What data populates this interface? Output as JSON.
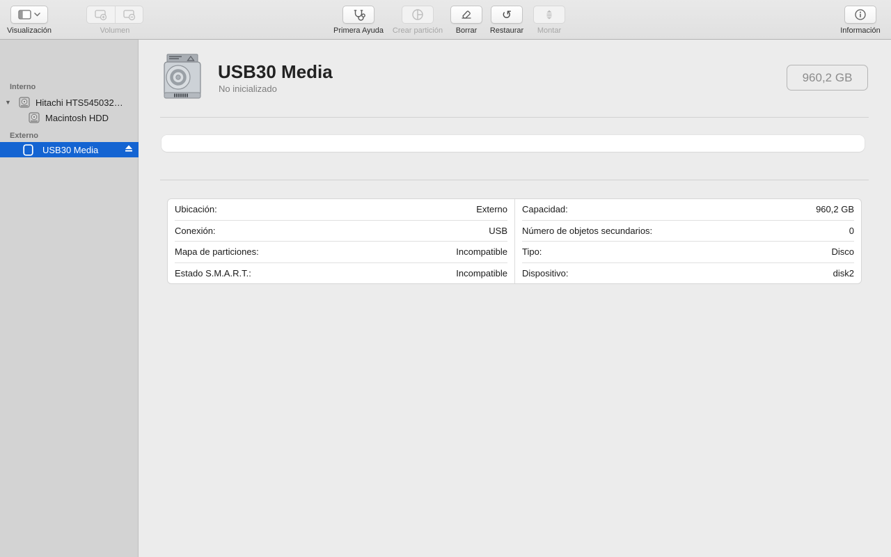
{
  "colors": {
    "selection_blue": "#1464d2"
  },
  "toolbar": {
    "visualizacion": {
      "label": "Visualización"
    },
    "volumen": {
      "label": "Volumen"
    },
    "primera_ayuda": {
      "label": "Primera Ayuda"
    },
    "crear_particion": {
      "label": "Crear partición"
    },
    "borrar": {
      "label": "Borrar"
    },
    "restaurar": {
      "label": "Restaurar",
      "glyph": "↺"
    },
    "montar": {
      "label": "Montar"
    },
    "informacion": {
      "label": "Información"
    }
  },
  "sidebar": {
    "sections": [
      {
        "title": "Interno",
        "items": [
          {
            "label": "Hitachi HTS545032…"
          },
          {
            "label": "Macintosh HDD"
          }
        ]
      },
      {
        "title": "Externo",
        "items": [
          {
            "label": "USB30 Media",
            "selected": true
          }
        ]
      }
    ]
  },
  "main": {
    "title": "USB30 Media",
    "subtitle": "No inicializado",
    "capacity_badge": "960,2 GB",
    "details": {
      "left": [
        {
          "label": "Ubicación:",
          "value": "Externo"
        },
        {
          "label": "Conexión:",
          "value": "USB"
        },
        {
          "label": "Mapa de particiones:",
          "value": "Incompatible"
        },
        {
          "label": "Estado S.M.A.R.T.:",
          "value": "Incompatible"
        }
      ],
      "right": [
        {
          "label": "Capacidad:",
          "value": "960,2 GB"
        },
        {
          "label": "Número de objetos secundarios:",
          "value": "0"
        },
        {
          "label": "Tipo:",
          "value": "Disco"
        },
        {
          "label": "Dispositivo:",
          "value": "disk2"
        }
      ]
    }
  }
}
